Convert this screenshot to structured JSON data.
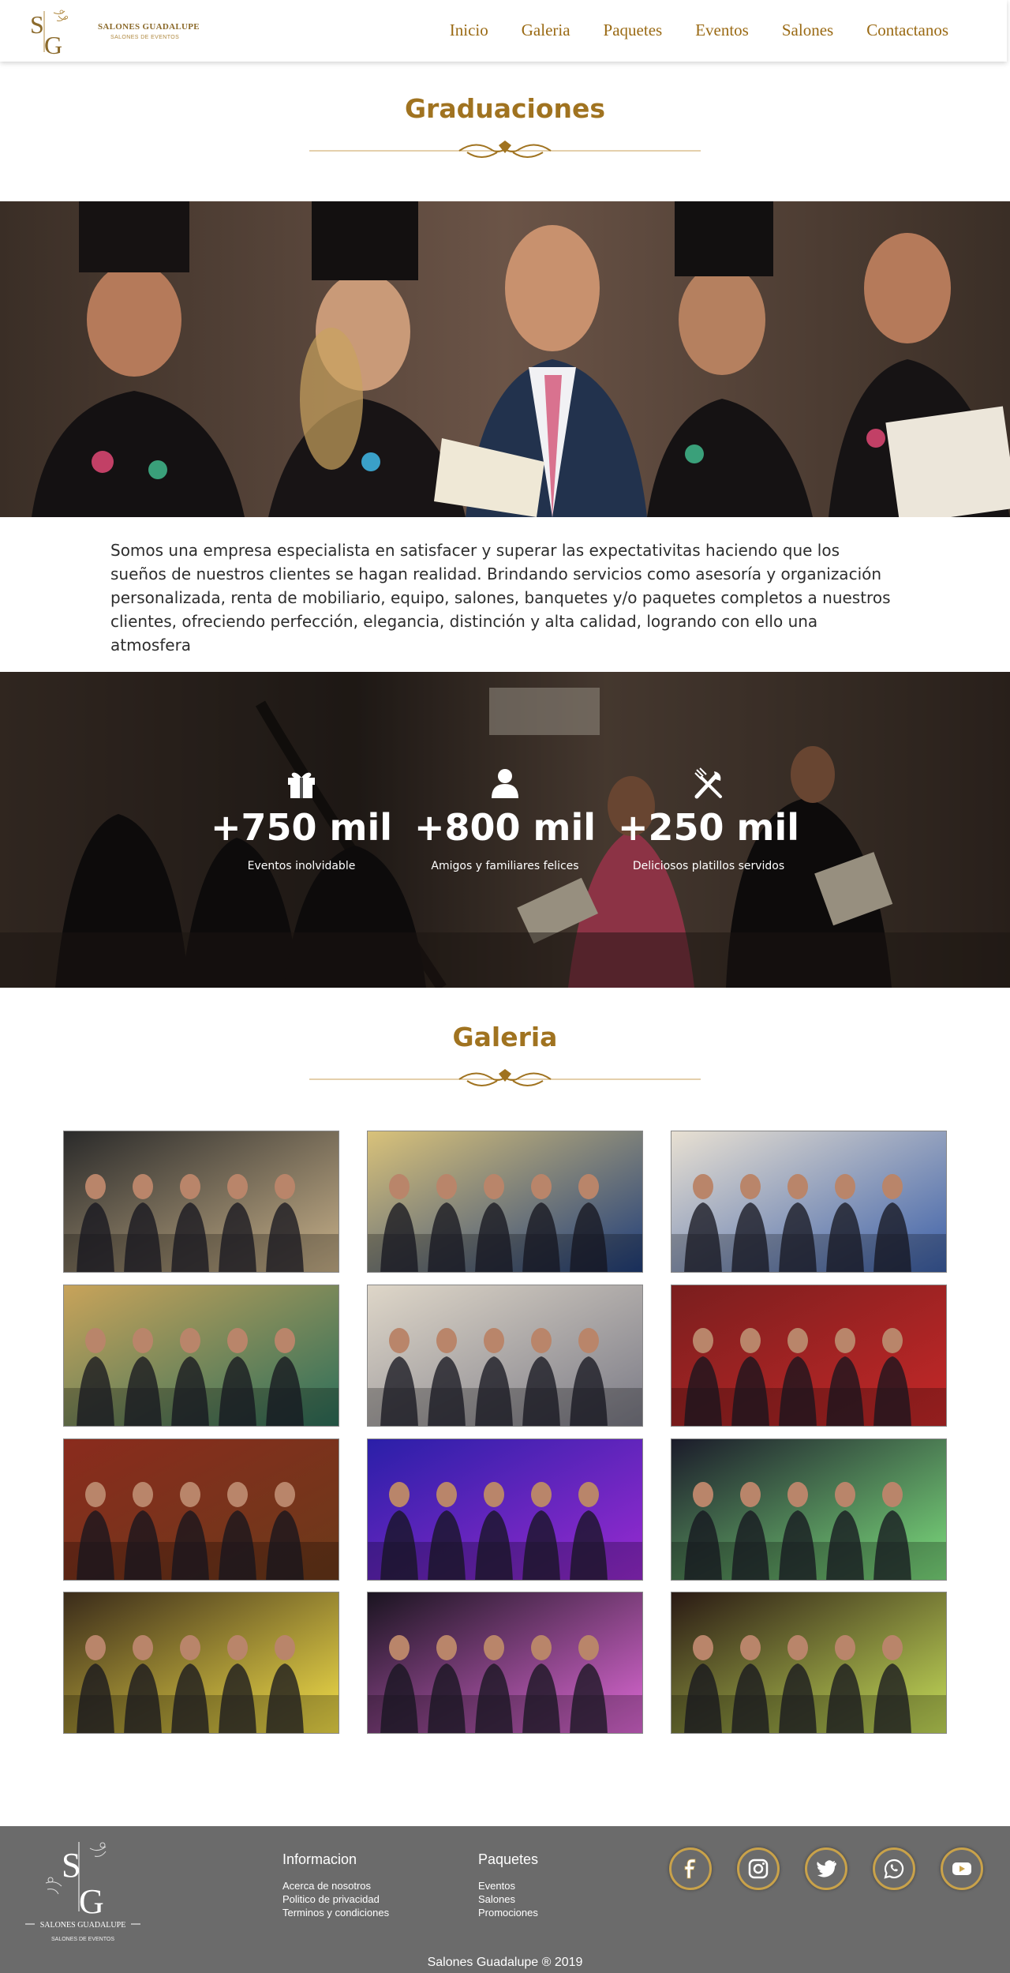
{
  "header": {
    "brand_name": "SALONES GUADALUPE",
    "brand_sub": "SALONES DE EVENTOS",
    "nav": [
      "Inicio",
      "Galeria",
      "Paquetes",
      "Eventos",
      "Salones",
      "Contactanos"
    ]
  },
  "hero": {
    "title": "Graduaciones"
  },
  "intro": {
    "text": "Somos una empresa especialista en satisfacer y superar las expectativitas haciendo que los  sueños de nuestros clientes se hagan  realidad. Brindando servicios como asesoría y organización personalizada, renta de mobiliario, equipo, salones, banquetes y/o  paquetes completos a nuestros clientes, ofreciendo perfección, elegancia, distinción y alta calidad, logrando  con ello  una  atmosfera"
  },
  "stats": [
    {
      "icon": "gift-icon",
      "number": "+750 mil",
      "label": "Eventos inolvidable"
    },
    {
      "icon": "person-icon",
      "number": "+800 mil",
      "label": "Amigos y familiares felices"
    },
    {
      "icon": "utensils-icon",
      "number": "+250 mil",
      "label": "Deliciosos platillos servidos"
    }
  ],
  "gallery": {
    "title": "Galeria",
    "photos": [
      {
        "scene": "couples-dinner-table",
        "palette": [
          "#2a2a2a",
          "#c9b28a"
        ]
      },
      {
        "scene": "group-courtyard",
        "palette": [
          "#d9c27a",
          "#1f3d7a"
        ]
      },
      {
        "scene": "group-columns",
        "palette": [
          "#e8e0d2",
          "#3b5fa8"
        ]
      },
      {
        "scene": "group-hall",
        "palette": [
          "#c8a35a",
          "#2b6e5a"
        ]
      },
      {
        "scene": "group-portrait",
        "palette": [
          "#ded6c8",
          "#7a7a86"
        ]
      },
      {
        "scene": "toast",
        "palette": [
          "#7a1e1e",
          "#c62828"
        ]
      },
      {
        "scene": "banquet-hall",
        "palette": [
          "#8a2b1d",
          "#6b3a1a"
        ]
      },
      {
        "scene": "dance-lights",
        "palette": [
          "#2a1fa8",
          "#9a2bd1"
        ]
      },
      {
        "scene": "green-lantern",
        "palette": [
          "#1b1b2a",
          "#7ee07e"
        ]
      },
      {
        "scene": "yellow-lantern",
        "palette": [
          "#3a2b1a",
          "#f6e24a"
        ]
      },
      {
        "scene": "pink-lantern",
        "palette": [
          "#1a1420",
          "#e06ad8"
        ]
      },
      {
        "scene": "lantern-release",
        "palette": [
          "#2a1a14",
          "#c8e05a"
        ]
      }
    ]
  },
  "footer": {
    "brand_name": "SALONES GUADALUPE",
    "brand_sub": "SALONES DE EVENTOS",
    "info_title": "Informacion",
    "info_links": [
      "Acerca de nosotros",
      "Politico de privacidad",
      "Terminos y condiciones"
    ],
    "packages_title": "Paquetes",
    "packages_links": [
      "Eventos",
      "Salones",
      "Promociones"
    ],
    "social": [
      "facebook-icon",
      "instagram-icon",
      "twitter-icon",
      "whatsapp-icon",
      "youtube-icon"
    ],
    "copyright": "Salones Guadalupe ® 2019"
  },
  "colors": {
    "gold": "#a07320",
    "nav": "#9a6a14",
    "footer_bg": "#6b6b6b",
    "social_ring": "#c9a24a"
  }
}
